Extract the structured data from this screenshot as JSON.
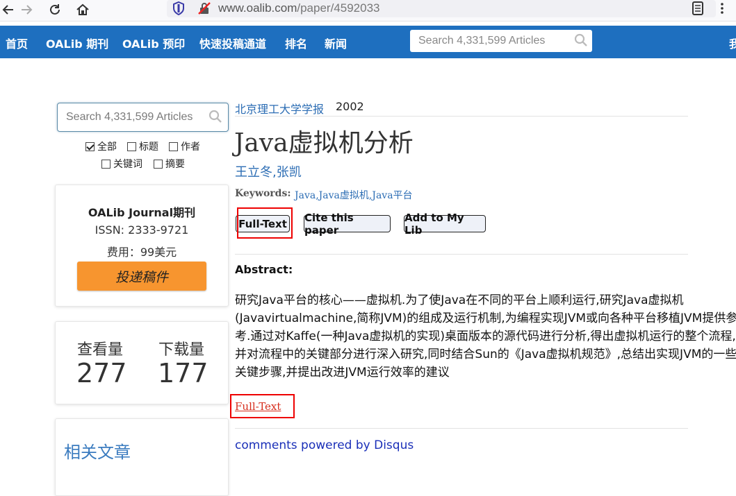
{
  "browser": {
    "url_host": "www.oalib.com",
    "url_path": "/paper/4592033"
  },
  "topnav": {
    "items": [
      "首页",
      "OALib 期刊",
      "OALib 预印",
      "快速投稿通道",
      "排名",
      "新闻"
    ],
    "search_placeholder": "Search 4,331,599 Articles",
    "edge_text": "我"
  },
  "sidebar": {
    "search_placeholder": "Search 4,331,599 Articles",
    "filters": [
      {
        "label": "全部",
        "checked": true
      },
      {
        "label": "标题",
        "checked": false
      },
      {
        "label": "作者",
        "checked": false
      },
      {
        "label": "关键词",
        "checked": false
      },
      {
        "label": "摘要",
        "checked": false
      }
    ],
    "journal": {
      "title": "OALib Journal期刊",
      "issn": "ISSN: 2333-9721",
      "fee": "费用：99美元",
      "submit_label": "投递稿件"
    },
    "stats": {
      "views_label": "查看量",
      "views_value": "277",
      "downloads_label": "下载量",
      "downloads_value": "177"
    },
    "related_title": "相关文章"
  },
  "paper": {
    "journal": "北京理工大学学报",
    "year": "2002",
    "title": "Java虚拟机分析",
    "authors": "王立冬,张凯",
    "keywords_label": "Keywords:",
    "keywords": "Java,Java虚拟机,Java平台",
    "buttons": {
      "fulltext": "Full-Text",
      "cite": "Cite this paper",
      "add": "Add to My Lib"
    },
    "abstract_label": "Abstract:",
    "abstract": "研究Java平台的核心——虚拟机.为了使Java在不同的平台上顺利运行,研究Java虚拟机(Javavirtualmachine,简称JVM)的组成及运行机制,为编程实现JVM或向各种平台移植JVM提供参考.通过对Kaffe(一种Java虚拟机的实现)桌面版本的源代码进行分析,得出虚拟机运行的整个流程,并对流程中的关键部分进行深入研究,同时结合Sun的《Java虚拟机规范》,总结出实现JVM的一些关键步骤,并提出改进JVM运行效率的建议",
    "fulltext_link": "Full-Text",
    "disqus": "comments powered by Disqus"
  },
  "colors": {
    "nav_bg": "#1e6fbf",
    "link": "#2c6db4",
    "submit_bg": "#f7952f",
    "highlight": "#ee0000"
  }
}
